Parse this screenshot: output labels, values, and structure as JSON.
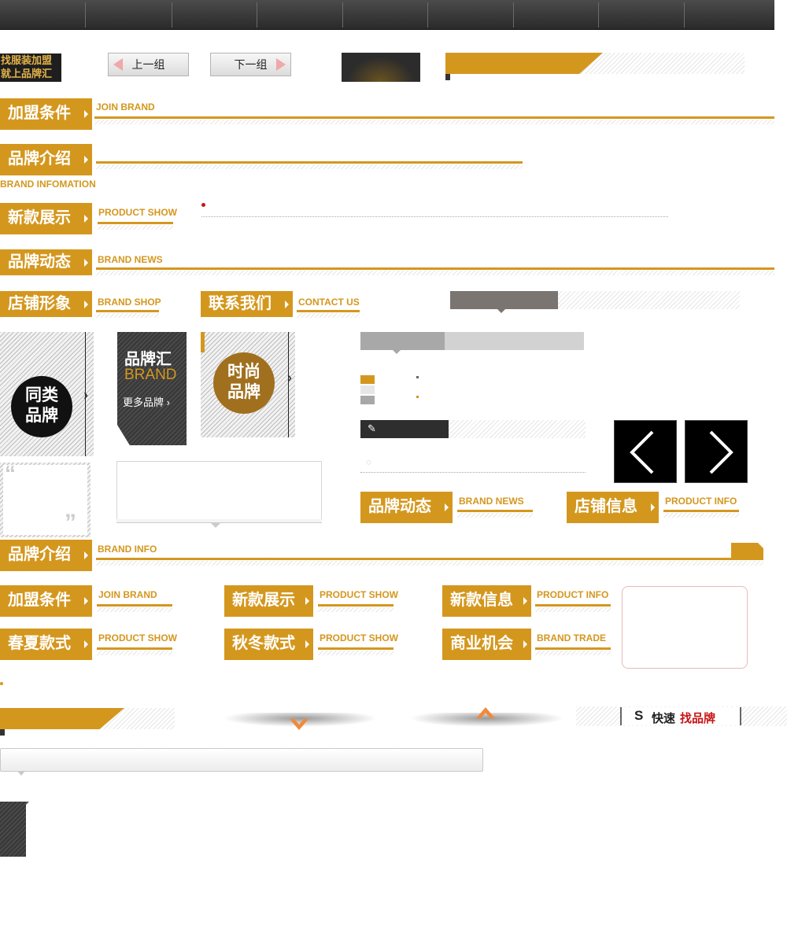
{
  "logo": {
    "line1": "找服装加盟",
    "line2": "就上品牌汇"
  },
  "nav_buttons": {
    "prev": "上一组",
    "next": "下一组"
  },
  "headers": {
    "join": {
      "cn": "加盟条件",
      "en": "JOIN BRAND"
    },
    "brand_intro": {
      "cn": "品牌介绍",
      "en": "BRAND INFOMATION"
    },
    "new_show": {
      "cn": "新款展示",
      "en": "PRODUCT SHOW"
    },
    "brand_news": {
      "cn": "品牌动态",
      "en": "BRAND NEWS"
    },
    "shop": {
      "cn": "店铺形象",
      "en": "BRAND SHOP"
    },
    "contact": {
      "cn": "联系我们",
      "en": "CONTACT US"
    },
    "brand_news2": {
      "cn": "品牌动态",
      "en": "BRAND NEWS"
    },
    "shop_info": {
      "cn": "店铺信息",
      "en": "PRODUCT INFO"
    },
    "brand_info": {
      "cn": "品牌介绍",
      "en": "BRAND INFO"
    },
    "join2": {
      "cn": "加盟条件",
      "en": "JOIN BRAND"
    },
    "new_show2": {
      "cn": "新款展示",
      "en": "PRODUCT SHOW"
    },
    "new_info": {
      "cn": "新款信息",
      "en": "PRODUCT INFO"
    },
    "spring": {
      "cn": "春夏款式",
      "en": "PRODUCT SHOW"
    },
    "autumn": {
      "cn": "秋冬款式",
      "en": "PRODUCT SHOW"
    },
    "biz": {
      "cn": "商业机会",
      "en": "BRAND TRADE"
    }
  },
  "tiles": {
    "similar": {
      "line1": "同类",
      "line2": "品牌"
    },
    "brandhui": {
      "title": "品牌汇",
      "en": "BRAND",
      "more": "更多品牌"
    },
    "fashion": {
      "line1": "时尚",
      "line2": "品牌"
    }
  },
  "quick_find": {
    "prefix": "快速",
    "highlight": "找品牌"
  },
  "colors": {
    "accent": "#d4971e",
    "dark": "#2b2b2b",
    "red": "#c81414"
  }
}
